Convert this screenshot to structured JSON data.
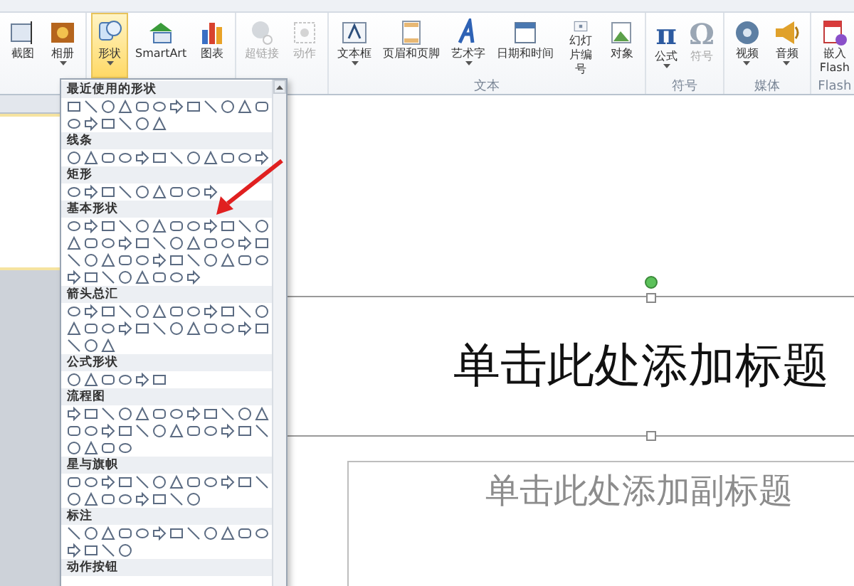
{
  "ribbon": {
    "groups": [
      {
        "buttons": [
          {
            "label": "截图",
            "kind": "screenshot",
            "dropdown": false,
            "disabled": false,
            "selected": false
          },
          {
            "label": "相册",
            "kind": "album",
            "dropdown": true,
            "disabled": false,
            "selected": false
          }
        ]
      },
      {
        "buttons": [
          {
            "label": "形状",
            "kind": "shapes",
            "dropdown": true,
            "disabled": false,
            "selected": true
          },
          {
            "label": "SmartArt",
            "kind": "smartart",
            "dropdown": false,
            "disabled": false,
            "selected": false
          },
          {
            "label": "图表",
            "kind": "chart",
            "dropdown": false,
            "disabled": false,
            "selected": false
          }
        ]
      },
      {
        "buttons": [
          {
            "label": "超链接",
            "kind": "hyperlink",
            "dropdown": false,
            "disabled": true,
            "selected": false
          },
          {
            "label": "动作",
            "kind": "action",
            "dropdown": false,
            "disabled": true,
            "selected": false
          }
        ]
      },
      {
        "label": "文本",
        "buttons": [
          {
            "label": "文本框",
            "kind": "textbox",
            "dropdown": true,
            "disabled": false,
            "selected": false
          },
          {
            "label": "页眉和页脚",
            "kind": "header",
            "dropdown": false,
            "disabled": false,
            "selected": false
          },
          {
            "label": "艺术字",
            "kind": "wordart",
            "dropdown": true,
            "disabled": false,
            "selected": false
          },
          {
            "label": "日期和时间",
            "kind": "datetime",
            "dropdown": false,
            "disabled": false,
            "selected": false
          },
          {
            "label": "幻灯片编号",
            "kind": "slidenum",
            "dropdown": false,
            "disabled": false,
            "selected": false
          },
          {
            "label": "对象",
            "kind": "object",
            "dropdown": false,
            "disabled": false,
            "selected": false
          }
        ]
      },
      {
        "label": "符号",
        "buttons": [
          {
            "label": "公式",
            "kind": "glyph",
            "glyph": "π",
            "dropdown": true,
            "disabled": false,
            "selected": false
          },
          {
            "label": "符号",
            "kind": "glyph",
            "glyph": "Ω",
            "dropdown": false,
            "disabled": true,
            "selected": false
          }
        ]
      },
      {
        "label": "媒体",
        "buttons": [
          {
            "label": "视频",
            "kind": "video",
            "dropdown": true,
            "disabled": false,
            "selected": false
          },
          {
            "label": "音频",
            "kind": "audio",
            "dropdown": true,
            "disabled": false,
            "selected": false
          }
        ]
      },
      {
        "label": "Flash",
        "buttons": [
          {
            "label": "嵌入\nFlash",
            "kind": "flash",
            "dropdown": false,
            "disabled": false,
            "selected": false
          }
        ]
      }
    ]
  },
  "shapes_menu": {
    "sections": [
      {
        "title": "最近使用的形状"
      },
      {
        "title": "线条"
      },
      {
        "title": "矩形"
      },
      {
        "title": "基本形状"
      },
      {
        "title": "箭头总汇"
      },
      {
        "title": "公式形状"
      },
      {
        "title": "流程图"
      },
      {
        "title": "星与旗帜"
      },
      {
        "title": "标注"
      },
      {
        "title": "动作按钮"
      }
    ]
  },
  "slide": {
    "title_placeholder": "单击此处添加标题",
    "subtitle_placeholder": "单击此处添加副标题"
  }
}
